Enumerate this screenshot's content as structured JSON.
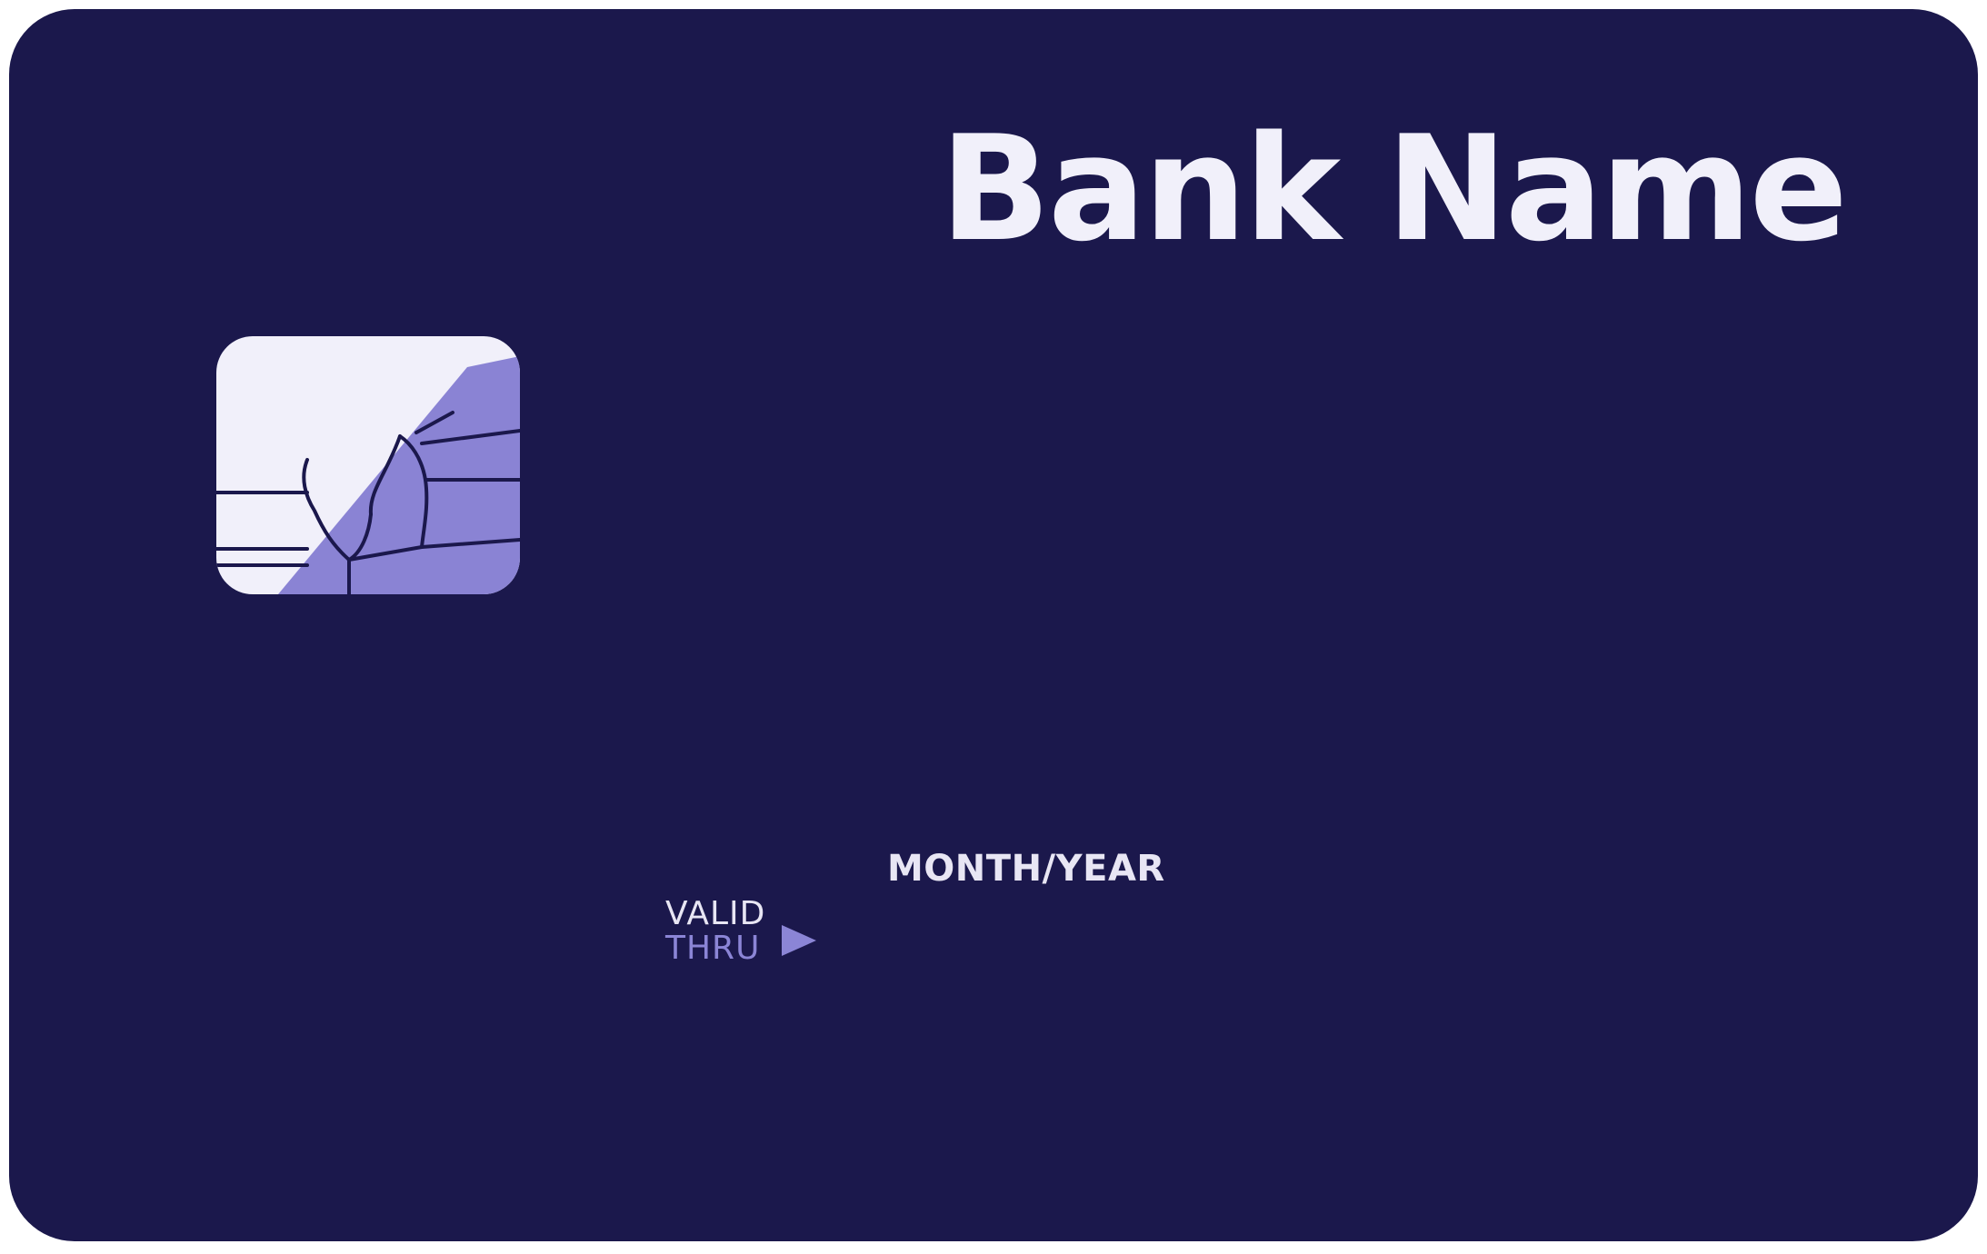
{
  "card": {
    "bank_name": "Bank Name",
    "valid_label_line1": "VALID",
    "valid_label_line2": "THRU",
    "expiry": "MONTH/YEAR",
    "colors": {
      "background": "#1b184c",
      "text": "#f1f0fa",
      "accent": "#8b85d6",
      "chip_light": "#f1f0fa",
      "chip_accent": "#8a83d4",
      "chip_lines": "#1b184c"
    },
    "icons": {
      "chip": "emv-chip-icon",
      "arrow": "play-triangle-icon"
    }
  }
}
